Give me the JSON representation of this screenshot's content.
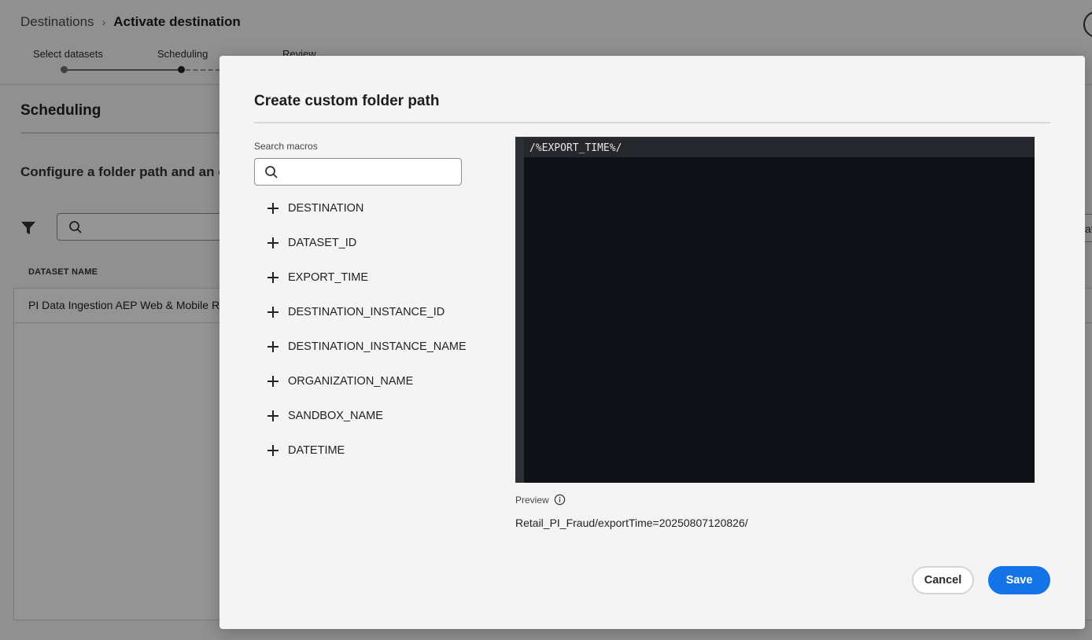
{
  "breadcrumb": {
    "parent": "Destinations",
    "separator": "›",
    "current": "Activate destination"
  },
  "stepper": {
    "steps": [
      "Select datasets",
      "Scheduling",
      "Review"
    ]
  },
  "background": {
    "section_title": "Scheduling",
    "configure_text": "Configure a folder path and an exp",
    "table_header": "DATASET NAME",
    "rows": [
      "PI Data Ingestion AEP Web & Mobile RT"
    ],
    "right_pill_text": "at"
  },
  "modal": {
    "title": "Create custom folder path",
    "search_label": "Search macros",
    "search_value": "",
    "macros": [
      "DESTINATION",
      "DATASET_ID",
      "EXPORT_TIME",
      "DESTINATION_INSTANCE_ID",
      "DESTINATION_INSTANCE_NAME",
      "ORGANIZATION_NAME",
      "SANDBOX_NAME",
      "DATETIME"
    ],
    "editor_code": "/%EXPORT_TIME%/",
    "preview_label": "Preview",
    "preview_value": "Retail_PI_Fraud/exportTime=20250807120826/",
    "cancel_label": "Cancel",
    "save_label": "Save"
  },
  "colors": {
    "accent": "#1473e6",
    "editor_bg": "#0f1116",
    "modal_bg": "#f4f4f4"
  }
}
